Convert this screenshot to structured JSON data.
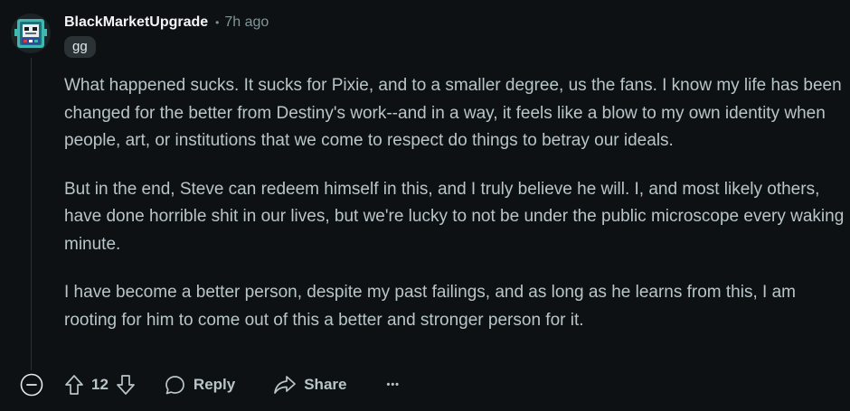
{
  "comment": {
    "author": "BlackMarketUpgrade",
    "separator": "•",
    "time_ago": "7h ago",
    "flair": "gg",
    "paragraphs": [
      "What happened sucks. It sucks for Pixie, and to a smaller degree, us the fans. I know my life has been changed for the better from Destiny's work--and in a way, it feels like a blow to my own identity when people, art, or institutions that we come to respect do things to betray our ideals.",
      "But in the end, Steve can redeem himself in this, and I truly believe he will. I, and most likely others, have done horrible shit in our lives, but we're lucky to not be under the public microscope every waking minute.",
      "I have become a better person, despite my past failings, and as long as he learns from this, I am rooting for him to come out of this a better and stronger person for it."
    ]
  },
  "actions": {
    "collapse_icon": "minus-circle-icon",
    "upvote_icon": "upvote-arrow-icon",
    "vote_count": "12",
    "downvote_icon": "downvote-arrow-icon",
    "reply_icon": "speech-bubble-icon",
    "reply_label": "Reply",
    "share_icon": "share-arrow-icon",
    "share_label": "Share",
    "more_icon": "ellipsis-icon",
    "more_label": "•••"
  },
  "colors": {
    "background": "#0e1113",
    "username": "#f2f4f5",
    "body_text": "#b8c5c9",
    "meta_text": "#82959b",
    "flair_bg": "#2a3236"
  }
}
